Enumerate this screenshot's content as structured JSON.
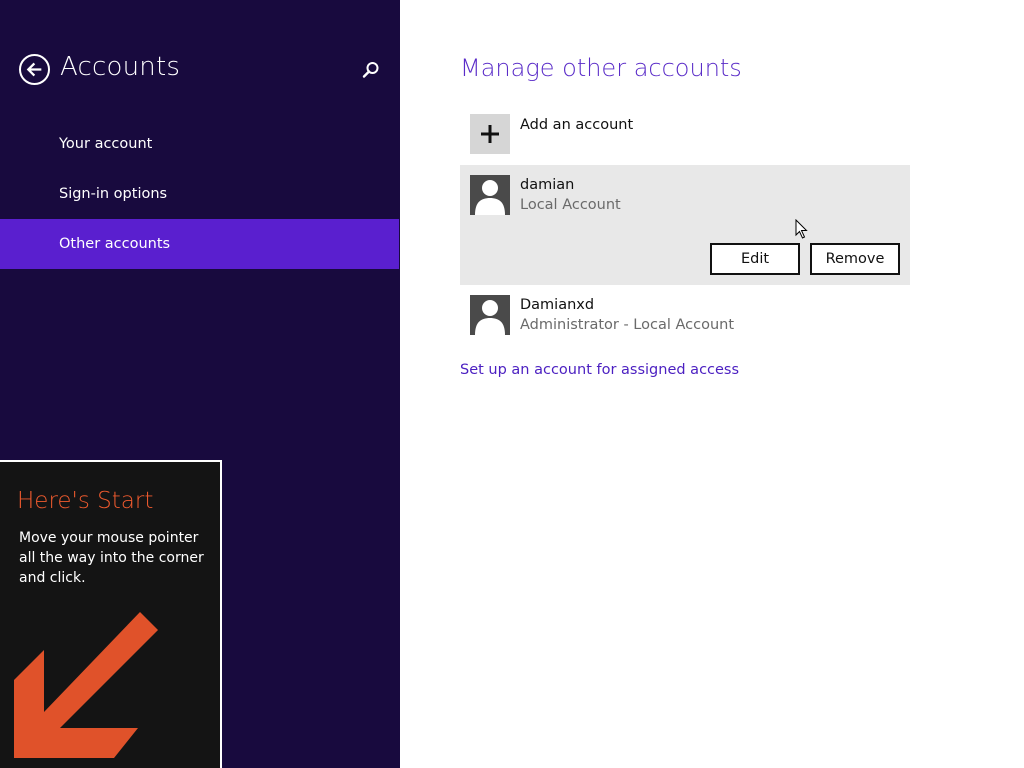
{
  "left_pane": {
    "title": "Accounts",
    "back_icon": "back-arrow-icon",
    "search_icon": "search-icon",
    "nav_items": [
      {
        "label": "Your account",
        "selected": false
      },
      {
        "label": "Sign-in options",
        "selected": false
      },
      {
        "label": "Other accounts",
        "selected": true
      }
    ],
    "background_color": "#180a3e",
    "selected_color": "#5a1fcf"
  },
  "start_tip": {
    "title": "Here's Start",
    "body": "Move your mouse pointer all the way into the corner and click.",
    "title_color": "#ef5a2e",
    "arrow_color": "#e0522a"
  },
  "main": {
    "title": "Manage other accounts",
    "title_color": "#5a2cc8",
    "add_account": {
      "label": "Add an account",
      "icon": "plus-icon"
    },
    "accounts": [
      {
        "name": "damian",
        "type": "Local Account",
        "expanded": true,
        "actions": {
          "edit": "Edit",
          "remove": "Remove"
        }
      },
      {
        "name": "Damianxd",
        "type": "Administrator - Local Account",
        "expanded": false
      }
    ],
    "assigned_access_link": "Set up an account for assigned access",
    "link_color": "#4b1fc1"
  }
}
